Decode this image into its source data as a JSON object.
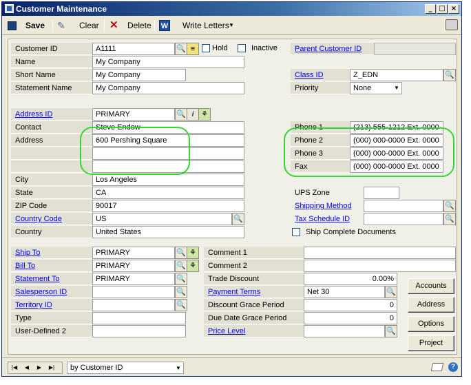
{
  "window": {
    "title": "Customer Maintenance"
  },
  "toolbar": {
    "save": "Save",
    "clear": "Clear",
    "delete": "Delete",
    "write_letters": "Write Letters"
  },
  "form": {
    "customer_id": {
      "label": "Customer ID",
      "value": "A1111"
    },
    "hold": {
      "label": "Hold",
      "checked": false
    },
    "inactive": {
      "label": "Inactive",
      "checked": false
    },
    "parent_customer_id": {
      "label": "Parent Customer ID",
      "value": ""
    },
    "name": {
      "label": "Name",
      "value": "My Company"
    },
    "short_name": {
      "label": "Short Name",
      "value": "My Company"
    },
    "class_id": {
      "label": "Class ID",
      "value": "Z_EDN"
    },
    "statement_name": {
      "label": "Statement Name",
      "value": "My Company"
    },
    "priority": {
      "label": "Priority",
      "value": "None"
    },
    "address_id": {
      "label": "Address ID",
      "value": "PRIMARY"
    },
    "contact": {
      "label": "Contact",
      "value": "Steve Endow"
    },
    "address": {
      "label": "Address",
      "line1": "600 Pershing Square",
      "line2": "",
      "line3": ""
    },
    "phone1": {
      "label": "Phone 1",
      "value": "(213) 555-1212  Ext. 0000"
    },
    "phone2": {
      "label": "Phone 2",
      "value": "(000) 000-0000  Ext. 0000"
    },
    "phone3": {
      "label": "Phone 3",
      "value": "(000) 000-0000  Ext. 0000"
    },
    "fax": {
      "label": "Fax",
      "value": "(000) 000-0000  Ext. 0000"
    },
    "city": {
      "label": "City",
      "value": "Los Angeles"
    },
    "state": {
      "label": "State",
      "value": "CA"
    },
    "ups_zone": {
      "label": "UPS Zone",
      "value": ""
    },
    "zip": {
      "label": "ZIP Code",
      "value": "90017"
    },
    "shipping_method": {
      "label": "Shipping Method",
      "value": ""
    },
    "country_code": {
      "label": "Country Code",
      "value": "US"
    },
    "tax_schedule_id": {
      "label": "Tax Schedule ID",
      "value": ""
    },
    "country": {
      "label": "Country",
      "value": "United States"
    },
    "ship_complete": {
      "label": "Ship Complete Documents",
      "checked": false
    },
    "ship_to": {
      "label": "Ship To",
      "value": "PRIMARY"
    },
    "comment1": {
      "label": "Comment 1",
      "value": ""
    },
    "bill_to": {
      "label": "Bill To",
      "value": "PRIMARY"
    },
    "comment2": {
      "label": "Comment 2",
      "value": ""
    },
    "statement_to": {
      "label": "Statement To",
      "value": "PRIMARY"
    },
    "trade_discount": {
      "label": "Trade Discount",
      "value": "0.00%"
    },
    "salesperson_id": {
      "label": "Salesperson ID",
      "value": ""
    },
    "payment_terms": {
      "label": "Payment Terms",
      "value": "Net 30"
    },
    "territory_id": {
      "label": "Territory ID",
      "value": ""
    },
    "discount_grace": {
      "label": "Discount Grace Period",
      "value": "0"
    },
    "type": {
      "label": "Type",
      "value": ""
    },
    "due_date_grace": {
      "label": "Due Date Grace Period",
      "value": "0"
    },
    "user_defined2": {
      "label": "User-Defined 2",
      "value": ""
    },
    "price_level": {
      "label": "Price Level",
      "value": ""
    }
  },
  "buttons": {
    "accounts": "Accounts",
    "address": "Address",
    "options": "Options",
    "project": "Project"
  },
  "status": {
    "sort_by": "by Customer ID"
  },
  "colors": {
    "highlight_oval": "#33d633",
    "link": "#0000ee",
    "title_bar": "#0a246a"
  }
}
